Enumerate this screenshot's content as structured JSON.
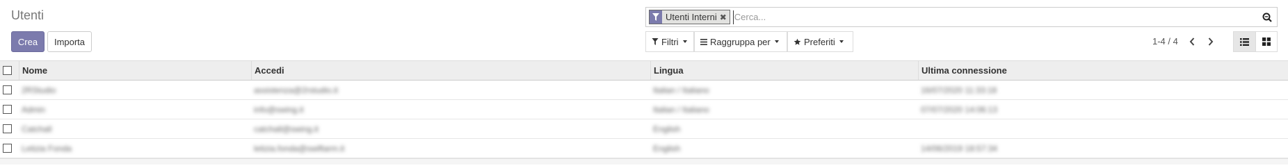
{
  "page": {
    "title": "Utenti"
  },
  "actions": {
    "create_label": "Crea",
    "import_label": "Importa"
  },
  "search": {
    "facet_label": "Utenti Interni",
    "placeholder": "Cerca..."
  },
  "toolbar": {
    "filters_label": "Filtri",
    "group_by_label": "Raggruppa per",
    "favorites_label": "Preferiti"
  },
  "pager": {
    "value": "1-4 / 4"
  },
  "table": {
    "columns": [
      "Nome",
      "Accedi",
      "Lingua",
      "Ultima connessione"
    ],
    "rows": [
      {
        "name": "2RStudio",
        "login": "assistenza@2rstudio.it",
        "language": "Italian / Italiano",
        "last_login": "16/07/2020 11:33:18"
      },
      {
        "name": "Admin",
        "login": "info@swing.it",
        "language": "Italian / Italiano",
        "last_login": "07/07/2020 14:06:13"
      },
      {
        "name": "Catchall",
        "login": "catchall@swing.it",
        "language": "English",
        "last_login": ""
      },
      {
        "name": "Letizia Fonda",
        "login": "letizia.fonda@swiftarm.it",
        "language": "English",
        "last_login": "14/06/2019 18:57:34"
      }
    ]
  },
  "colors": {
    "accent": "#7c7bad",
    "header_bg": "#eeeeee"
  },
  "icons": [
    "filter-icon",
    "remove-facet-icon",
    "search-icon",
    "bars-icon",
    "star-icon",
    "chevron-left-icon",
    "chevron-right-icon",
    "list-view-icon",
    "kanban-view-icon"
  ]
}
